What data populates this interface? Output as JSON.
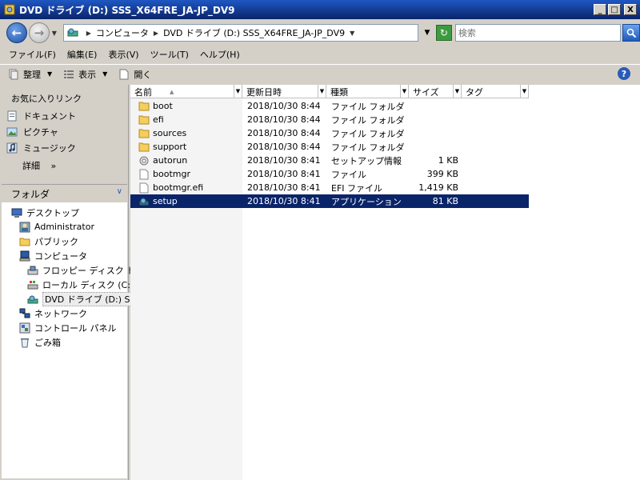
{
  "window": {
    "title": "DVD ドライブ (D:) SSS_X64FRE_JA-JP_DV9",
    "min_label": "_",
    "max_label": "□",
    "close_label": "X"
  },
  "address": {
    "segments": [
      "コンピュータ",
      "DVD ドライブ (D:) SSS_X64FRE_JA-JP_DV9"
    ],
    "search_placeholder": "検索"
  },
  "menu": [
    "ファイル(F)",
    "編集(E)",
    "表示(V)",
    "ツール(T)",
    "ヘルプ(H)"
  ],
  "toolbar": {
    "organize": "整理",
    "views": "表示",
    "open": "開く"
  },
  "favorites": {
    "header": "お気に入りリンク",
    "items": [
      "ドキュメント",
      "ピクチャ",
      "ミュージック"
    ],
    "more": "詳細",
    "more_chevron": "»"
  },
  "folders": {
    "header": "フォルダ",
    "tree": [
      {
        "label": "デスクトップ",
        "icon": "desktop-icon"
      },
      {
        "label": "Administrator",
        "icon": "user-icon"
      },
      {
        "label": "パブリック",
        "icon": "folder-icon"
      },
      {
        "label": "コンピュータ",
        "icon": "computer-icon"
      },
      {
        "label": "フロッピー ディスク ドラ",
        "icon": "floppy-icon"
      },
      {
        "label": "ローカル ディスク (C:)",
        "icon": "disk-icon"
      },
      {
        "label": "DVD ドライブ (D:) SSS",
        "icon": "dvd-icon"
      },
      {
        "label": "ネットワーク",
        "icon": "network-icon"
      },
      {
        "label": "コントロール パネル",
        "icon": "control-panel-icon"
      },
      {
        "label": "ごみ箱",
        "icon": "recycle-bin-icon"
      }
    ]
  },
  "columns": {
    "name": "名前",
    "date": "更新日時",
    "type": "種類",
    "size": "サイズ",
    "tag": "タグ"
  },
  "files": [
    {
      "name": "boot",
      "date": "2018/10/30 8:44",
      "type": "ファイル フォルダ",
      "size": "",
      "icon": "folder-icon"
    },
    {
      "name": "efi",
      "date": "2018/10/30 8:44",
      "type": "ファイル フォルダ",
      "size": "",
      "icon": "folder-icon"
    },
    {
      "name": "sources",
      "date": "2018/10/30 8:44",
      "type": "ファイル フォルダ",
      "size": "",
      "icon": "folder-icon"
    },
    {
      "name": "support",
      "date": "2018/10/30 8:44",
      "type": "ファイル フォルダ",
      "size": "",
      "icon": "folder-icon"
    },
    {
      "name": "autorun",
      "date": "2018/10/30 8:41",
      "type": "セットアップ情報",
      "size": "1 KB",
      "icon": "settings-file-icon"
    },
    {
      "name": "bootmgr",
      "date": "2018/10/30 8:41",
      "type": "ファイル",
      "size": "399 KB",
      "icon": "file-icon"
    },
    {
      "name": "bootmgr.efi",
      "date": "2018/10/30 8:41",
      "type": "EFI ファイル",
      "size": "1,419 KB",
      "icon": "file-icon"
    },
    {
      "name": "setup",
      "date": "2018/10/30 8:41",
      "type": "アプリケーション",
      "size": "81 KB",
      "icon": "setup-app-icon",
      "selected": true
    }
  ]
}
